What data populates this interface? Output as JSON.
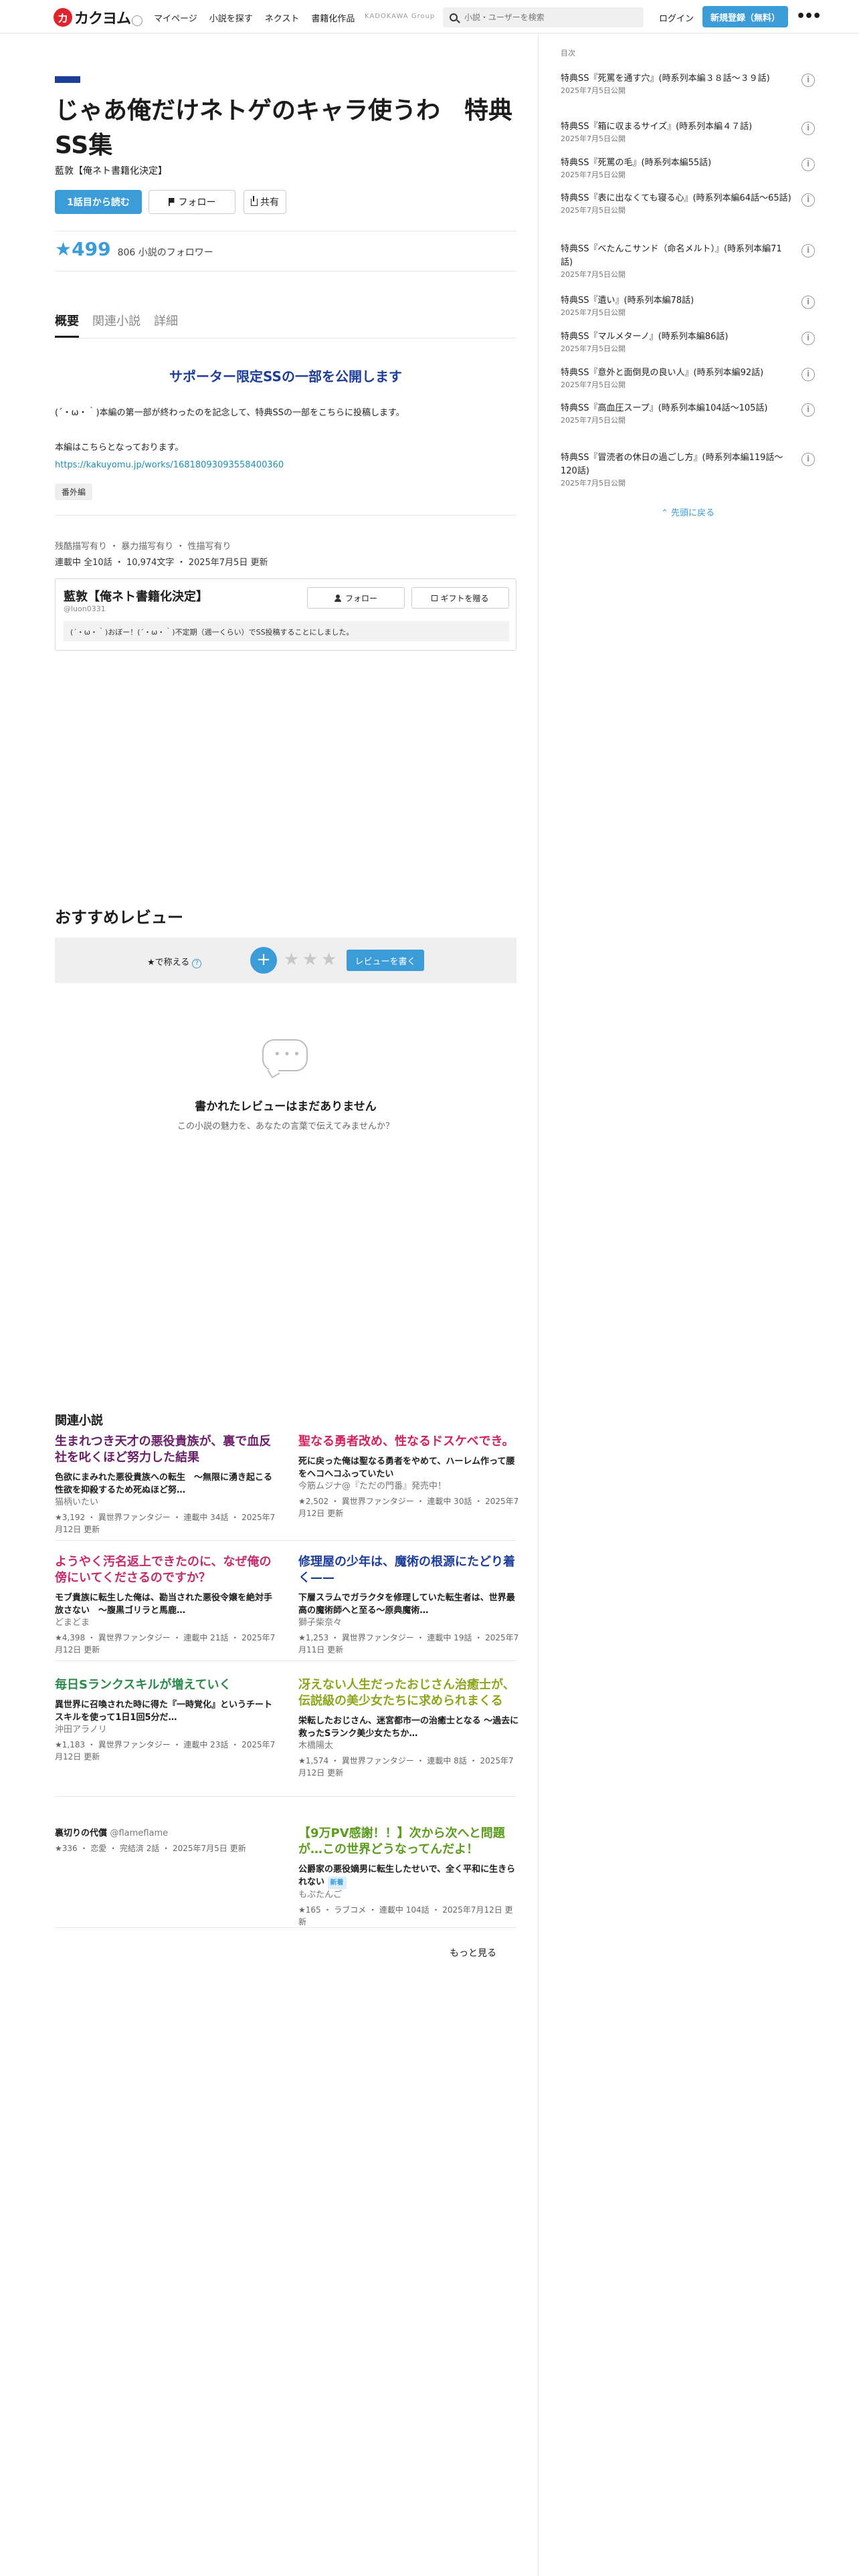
{
  "header": {
    "logo_mark": "カ",
    "logo_text": "カクヨム",
    "nav": [
      "マイページ",
      "小説を探す",
      "ネクスト",
      "書籍化作品"
    ],
    "group_label": "KADOKAWA Group",
    "search_placeholder": "小説・ユーザーを検索",
    "login_label": "ログイン",
    "signup_label": "新規登録（無料）"
  },
  "work": {
    "title": "じゃあ俺だけネトゲのキャラ使うわ　特典SS集",
    "author": "藍敦【俺ネト書籍化決定】",
    "read_button": "1話目から読む",
    "follow_button": "フォロー",
    "share_button": "共有",
    "stars": "★499",
    "followers": "806 小説のフォロワー",
    "tabs": [
      "概要",
      "関連小説",
      "詳細"
    ],
    "catchphrase": "サポーター限定SSの一部を公開します",
    "intro_line1": "(´・ω・｀)本編の第一部が終わったのを記念して、特典SSの一部をこちらに投稿します。",
    "intro_line2": "本編はこちらとなっております。",
    "intro_link": "https://kakuyomu.jp/works/16818093093558400360",
    "tag": "番外編",
    "content_warnings": "残酷描写有り ・ 暴力描写有り ・ 性描写有り",
    "status": "連載中 全10話 ・ 10,974文字 ・ 2025年7月5日 更新"
  },
  "author_box": {
    "name": "藍敦【俺ネト書籍化決定】",
    "id": "@luon0331",
    "follow_label": "フォロー",
    "gift_label": "ギフトを贈る",
    "intro": "(´・ω・｀)おぼー！(´・ω・｀)不定期（週一くらい）でSS投稿することにしました。"
  },
  "reviews": {
    "heading": "おすすめレビュー",
    "rate_label": "★で称える",
    "help": "?",
    "plus": "+",
    "stars": [
      "★",
      "★",
      "★"
    ],
    "write_label": "レビューを書く",
    "empty_title": "書かれたレビューはまだありません",
    "empty_sub": "この小説の魅力を、あなたの言葉で伝えてみませんか？"
  },
  "related": {
    "heading": "関連小説",
    "items": [
      {
        "title": "生まれつき天才の悪役貴族が、裏で血反社を叱くほど努力した結果",
        "color": "#6b1f6b",
        "catch": "色欲にまみれた悪役貴族への転生　〜無限に湧き起こる性欲を抑殺するため死ぬほど努…",
        "author": "猫柄いたい",
        "meta": "★3,192 ・ 異世界ファンタジー ・ 連載中 34話 ・ 2025年7月12日 更新"
      },
      {
        "title": "聖なる勇者改め、性なるドスケベでき。",
        "color": "#d1245e",
        "catch": "死に戻った俺は聖なる勇者をやめて、ハーレム作って腰をヘコヘコふっていたい",
        "author": "今筋ムジナ@『ただの門番』発売中！",
        "meta": "★2,502 ・ 異世界ファンタジー ・ 連載中 30話 ・ 2025年7月12日 更新"
      },
      {
        "title": "ようやく汚名返上できたのに、なぜ俺の傍にいてくださるのですか？",
        "color": "#c42d6d",
        "catch": "モブ貴族に転生した俺は、勘当された悪役令嬢を絶対手放さない　〜腹黒ゴリラと馬鹿…",
        "author": "どまどま",
        "meta": "★4,398 ・ 異世界ファンタジー ・ 連載中 21話 ・ 2025年7月12日 更新"
      },
      {
        "title": "修理屋の少年は、魔術の根源にたどり着く——",
        "color": "#1c3d9a",
        "catch": "下層スラムでガラクタを修理していた転生者は、世界最高の魔術師へと至る〜原典魔術…",
        "author": "獅子柴奈々",
        "meta": "★1,253 ・ 異世界ファンタジー ・ 連載中 19話 ・ 2025年7月11日 更新"
      },
      {
        "title": "毎日Sランクスキルが増えていく",
        "color": "#2a8a4a",
        "catch": "異世界に召喚された時に得た『一時覚化』というチートスキルを使って1日1回5分だ…",
        "author": "沖田アラノリ",
        "meta": "★1,183 ・ 異世界ファンタジー ・ 連載中 23話 ・ 2025年7月12日 更新"
      },
      {
        "title": "冴えない人生だったおじさん治癒士が、伝説級の美少女たちに求められまくる",
        "color": "#8ca61c",
        "catch": "栄転したおじさん、迷宮都市一の治癒士となる 〜過去に救ったSランク美少女たちか…",
        "author": "木橋陽太",
        "meta": "★1,574 ・ 異世界ファンタジー ・ 連載中 8話 ・ 2025年7月12日 更新"
      },
      {
        "title": "裏切りの代償",
        "author": "@flameflame",
        "meta": "★336 ・ 恋愛 ・ 完結済 2話 ・ 2025年7月5日 更新"
      },
      {
        "title": "【9万PV感謝！！】次から次へと問題が…この世界どうなってんだよ！",
        "color": "#5a9c1c",
        "catch": "公爵家の悪役嫡男に転生したせいで、全く平和に生きられない",
        "badge": "新着",
        "author": "もぷたんご",
        "meta": "★165 ・ ラブコメ ・ 連載中 104話 ・ 2025年7月12日 更新"
      }
    ],
    "more_label": "もっと見る"
  },
  "sidebar": {
    "heading": "目次",
    "episodes": [
      {
        "title": "特典SS『死罵を通す穴』(時系列本編３８話〜３９話)",
        "date": "2025年7月5日公開"
      },
      {
        "title": "特典SS『箱に収まるサイズ』(時系列本編４７話)",
        "date": "2025年7月5日公開"
      },
      {
        "title": "特典SS『死罵の毛』(時系列本編55話)",
        "date": "2025年7月5日公開"
      },
      {
        "title": "特典SS『表に出なくても寝る心』(時系列本編64話〜65話)",
        "date": "2025年7月5日公開"
      },
      {
        "title": "特典SS『べたんこサンド（命名メルト）』(時系列本編71話)",
        "date": "2025年7月5日公開"
      },
      {
        "title": "特典SS『遺い』(時系列本編78話)",
        "date": "2025年7月5日公開"
      },
      {
        "title": "特典SS『マルメターノ』(時系列本編86話)",
        "date": "2025年7月5日公開"
      },
      {
        "title": "特典SS『意外と面倒見の良い人』(時系列本編92話)",
        "date": "2025年7月5日公開"
      },
      {
        "title": "特典SS『高血圧スープ』(時系列本編104話〜105話)",
        "date": "2025年7月5日公開"
      },
      {
        "title": "特典SS『冒涜者の休日の過ごし方』(時系列本編119話〜120話)",
        "date": "2025年7月5日公開"
      }
    ],
    "info_symbol": "i",
    "to_top_label": "先頭に戻る"
  }
}
